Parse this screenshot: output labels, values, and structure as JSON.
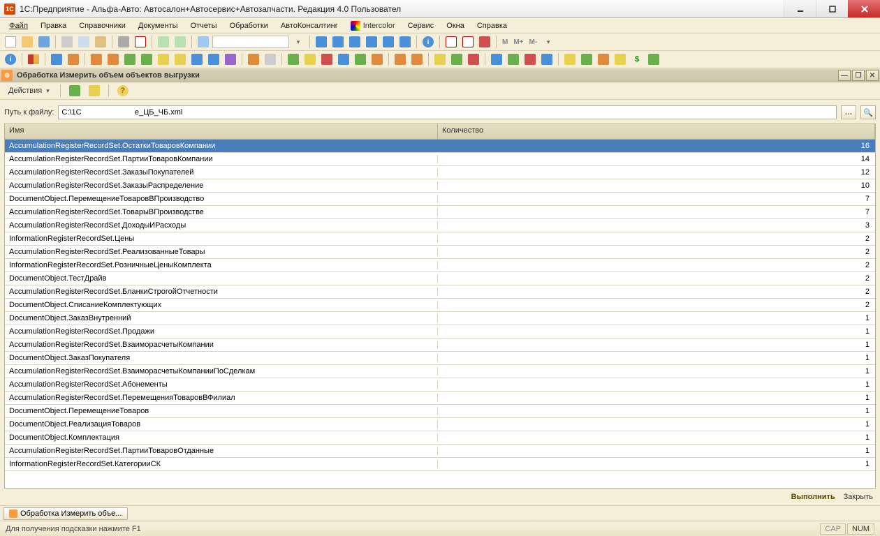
{
  "window": {
    "title": "1С:Предприятие - Альфа-Авто: Автосалон+Автосервис+Автозапчасти. Редакция 4.0   Пользовател"
  },
  "menu": {
    "file": "Файл",
    "edit": "Правка",
    "catalogs": "Справочники",
    "documents": "Документы",
    "reports": "Отчеты",
    "processing": "Обработки",
    "autoconsulting": "АвтоКонсалтинг",
    "intercolor": "Intercolor",
    "service": "Сервис",
    "windows": "Окна",
    "help": "Справка"
  },
  "subwindow": {
    "title": "Обработка  Измерить объем объектов выгрузки"
  },
  "actions": {
    "label": "Действия"
  },
  "path": {
    "label": "Путь к файлу:",
    "value": "C:\\1C                         е_ЦБ_ЧБ.xml"
  },
  "grid": {
    "headers": {
      "name": "Имя",
      "qty": "Количество"
    },
    "rows": [
      {
        "name": "AccumulationRegisterRecordSet.ОстаткиТоваровКомпании",
        "qty": 16,
        "selected": true
      },
      {
        "name": "AccumulationRegisterRecordSet.ПартииТоваровКомпании",
        "qty": 14
      },
      {
        "name": "AccumulationRegisterRecordSet.ЗаказыПокупателей",
        "qty": 12
      },
      {
        "name": "AccumulationRegisterRecordSet.ЗаказыРаспределение",
        "qty": 10
      },
      {
        "name": "DocumentObject.ПеремещениеТоваровВПроизводство",
        "qty": 7
      },
      {
        "name": "AccumulationRegisterRecordSet.ТоварыВПроизводстве",
        "qty": 7
      },
      {
        "name": "AccumulationRegisterRecordSet.ДоходыИРасходы",
        "qty": 3
      },
      {
        "name": "InformationRegisterRecordSet.Цены",
        "qty": 2
      },
      {
        "name": "AccumulationRegisterRecordSet.РеализованныеТовары",
        "qty": 2
      },
      {
        "name": "InformationRegisterRecordSet.РозничныеЦеныКомплекта",
        "qty": 2
      },
      {
        "name": "DocumentObject.ТестДрайв",
        "qty": 2
      },
      {
        "name": "AccumulationRegisterRecordSet.БланкиСтрогойОтчетности",
        "qty": 2
      },
      {
        "name": "DocumentObject.СписаниеКомплектующих",
        "qty": 2
      },
      {
        "name": "DocumentObject.ЗаказВнутренний",
        "qty": 1
      },
      {
        "name": "AccumulationRegisterRecordSet.Продажи",
        "qty": 1
      },
      {
        "name": "AccumulationRegisterRecordSet.ВзаиморасчетыКомпании",
        "qty": 1
      },
      {
        "name": "DocumentObject.ЗаказПокупателя",
        "qty": 1
      },
      {
        "name": "AccumulationRegisterRecordSet.ВзаиморасчетыКомпанииПоСделкам",
        "qty": 1
      },
      {
        "name": "AccumulationRegisterRecordSet.Абонементы",
        "qty": 1
      },
      {
        "name": "AccumulationRegisterRecordSet.ПеремещенияТоваровВФилиал",
        "qty": 1
      },
      {
        "name": "DocumentObject.ПеремещениеТоваров",
        "qty": 1
      },
      {
        "name": "DocumentObject.РеализацияТоваров",
        "qty": 1
      },
      {
        "name": "DocumentObject.Комплектация",
        "qty": 1
      },
      {
        "name": "AccumulationRegisterRecordSet.ПартииТоваровОтданные",
        "qty": 1
      },
      {
        "name": "InformationRegisterRecordSet.КатегорииСК",
        "qty": 1
      }
    ]
  },
  "buttons": {
    "run": "Выполнить",
    "close": "Закрыть"
  },
  "taskbar": {
    "tab": "Обработка  Измерить объе..."
  },
  "status": {
    "hint": "Для получения подсказки нажмите F1",
    "cap": "CAP",
    "num": "NUM"
  },
  "toolbar_text": {
    "m": "M",
    "mplus": "M+",
    "mminus": "M-"
  }
}
